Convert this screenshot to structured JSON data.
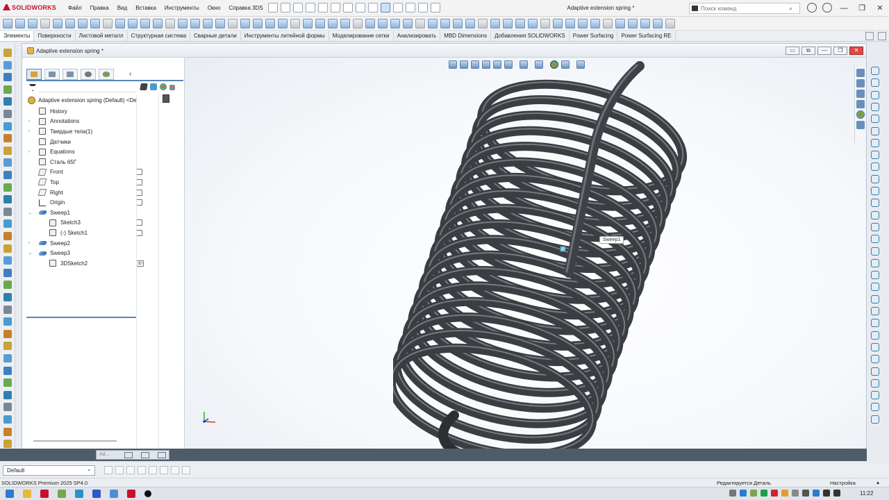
{
  "app": {
    "brand": "SOLIDWORKS",
    "menu": [
      "Файл",
      "Правка",
      "Вид",
      "Вставка",
      "Инструменты",
      "Окно",
      "Справка 3DS"
    ],
    "document_title": "Adaptive extension spring *",
    "search_placeholder": "Поиск команд",
    "window_controls": [
      "—",
      "❐",
      "✕"
    ]
  },
  "ribbon_tabs": [
    {
      "label": "Элементы",
      "active": true
    },
    {
      "label": "Поверхности"
    },
    {
      "label": "Листовой металл"
    },
    {
      "label": "Структурная система"
    },
    {
      "label": "Сварные детали"
    },
    {
      "label": "Инструменты литейной формы"
    },
    {
      "label": "Моделирование сетки"
    },
    {
      "label": "Анализировать"
    },
    {
      "label": "MBD Dimensions"
    },
    {
      "label": "Добавления SOLIDWORKS"
    },
    {
      "label": "Power Surfacing"
    },
    {
      "label": "Power Surfacing RE"
    }
  ],
  "document_window": {
    "title": "Adaptive extension spring *"
  },
  "feature_tree": {
    "root": "Adaptive extension spring  (Default) <De",
    "items": [
      {
        "label": "History",
        "indent": 0,
        "expander": "",
        "icon": "history"
      },
      {
        "label": "Annotations",
        "indent": 0,
        "expander": "›",
        "icon": "annotations"
      },
      {
        "label": "Твердые тела(1)",
        "indent": 0,
        "expander": "›",
        "icon": "solid-bodies"
      },
      {
        "label": "Датчики",
        "indent": 0,
        "expander": "",
        "icon": "sensors"
      },
      {
        "label": "Equations",
        "indent": 0,
        "expander": "›",
        "icon": "equations"
      },
      {
        "label": "Сталь 65Г",
        "indent": 0,
        "expander": "",
        "icon": "material"
      },
      {
        "label": "Front",
        "indent": 0,
        "expander": "",
        "icon": "plane",
        "flag": true
      },
      {
        "label": "Top",
        "indent": 0,
        "expander": "",
        "icon": "plane",
        "flag": true
      },
      {
        "label": "Right",
        "indent": 0,
        "expander": "",
        "icon": "plane",
        "flag": true
      },
      {
        "label": "Origin",
        "indent": 0,
        "expander": "",
        "icon": "origin",
        "flag": true
      },
      {
        "label": "Sweep1",
        "indent": 0,
        "expander": "⌄",
        "icon": "sweep"
      },
      {
        "label": "Sketch3",
        "indent": 1,
        "expander": "",
        "icon": "sketch",
        "flag": true
      },
      {
        "label": "(-) Sketch1",
        "indent": 1,
        "expander": "",
        "icon": "sketch",
        "flag": true
      },
      {
        "label": "Sweep2",
        "indent": 0,
        "expander": "›",
        "icon": "sweep"
      },
      {
        "label": "Sweep3",
        "indent": 0,
        "expander": "⌄",
        "icon": "sweep"
      },
      {
        "label": "3DSketch2",
        "indent": 1,
        "expander": "",
        "icon": "3d-sketch",
        "flag_text": "3D"
      }
    ]
  },
  "graphics": {
    "tooltip": "Sweep1"
  },
  "bottom": {
    "doc_tab_label": "Ad...",
    "configuration": "Default"
  },
  "status": {
    "version": "SOLIDWORKS Premium 2025 SP4.0",
    "editing": "Редактируется Деталь",
    "customize": "Настройка"
  },
  "taskbar": {
    "time": "11:22"
  },
  "colors": {
    "accent": "#5585bd",
    "brand_red": "#c8102e",
    "spring": "#3a3d41"
  }
}
